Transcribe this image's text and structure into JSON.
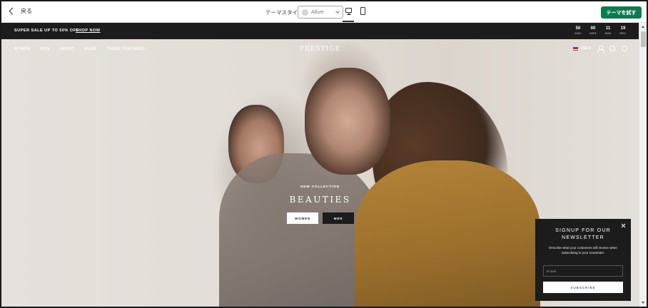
{
  "editor": {
    "back_label": "戻る",
    "theme_style_label": "テーマスタイル",
    "theme_select_value": "Allure",
    "try_theme_label": "テーマを試す",
    "accent_color": "#0e7a4f"
  },
  "announcement": {
    "promo_text": "SUPER SALE UP TO 50% OFF",
    "shop_now_label": "SHOP NOW",
    "countdown": [
      {
        "value": "50",
        "label": "DAY"
      },
      {
        "value": "00",
        "label": "HRS"
      },
      {
        "value": "11",
        "label": "MIN"
      },
      {
        "value": "19",
        "label": "SEC"
      }
    ]
  },
  "header": {
    "nav": [
      "WOMEN",
      "MEN",
      "ABOUT",
      "BLOG",
      "THEME FEATURES"
    ],
    "logo": "PRESTIGE",
    "currency": "USD $"
  },
  "hero": {
    "kicker": "NEW COLLECTION",
    "headline": "BEAUTIES",
    "cta_women": "WOMEN",
    "cta_men": "MEN"
  },
  "newsletter": {
    "title": "SIGNUP FOR OUR NEWSLETTER",
    "description": "Describe what your customers will receive when subscribing to your newsletter.",
    "email_placeholder": "E-mail",
    "subscribe_label": "SUBSCRIBE"
  }
}
